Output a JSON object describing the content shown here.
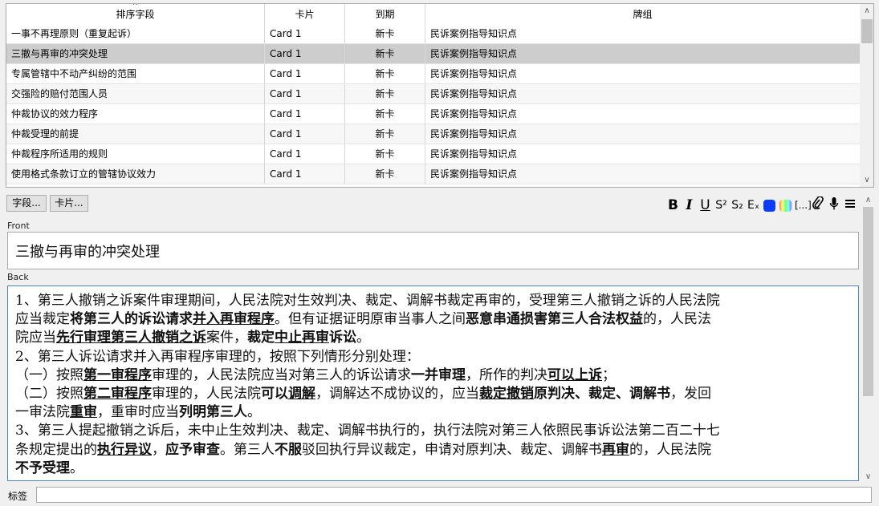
{
  "table": {
    "columns": [
      "排序字段",
      "卡片",
      "到期",
      "牌组"
    ],
    "sort_indicator": "^",
    "rows": [
      {
        "sort_field": "一事不再理原则（重复起诉）",
        "card": "Card 1",
        "due": "新卡",
        "deck": "民诉案例指导知识点",
        "selected": false
      },
      {
        "sort_field": "三撤与再审的冲突处理",
        "card": "Card 1",
        "due": "新卡",
        "deck": "民诉案例指导知识点",
        "selected": true
      },
      {
        "sort_field": "专属管辖中不动产纠纷的范围",
        "card": "Card 1",
        "due": "新卡",
        "deck": "民诉案例指导知识点",
        "selected": false
      },
      {
        "sort_field": "交强险的赔付范围人员",
        "card": "Card 1",
        "due": "新卡",
        "deck": "民诉案例指导知识点",
        "selected": false
      },
      {
        "sort_field": "仲裁协议的效力程序",
        "card": "Card 1",
        "due": "新卡",
        "deck": "民诉案例指导知识点",
        "selected": false
      },
      {
        "sort_field": "仲裁受理的前提",
        "card": "Card 1",
        "due": "新卡",
        "deck": "民诉案例指导知识点",
        "selected": false
      },
      {
        "sort_field": "仲裁程序所适用的规则",
        "card": "Card 1",
        "due": "新卡",
        "deck": "民诉案例指导知识点",
        "selected": false
      },
      {
        "sort_field": "使用格式条款订立的管辖协议效力",
        "card": "Card 1",
        "due": "新卡",
        "deck": "民诉案例指导知识点",
        "selected": false
      }
    ]
  },
  "buttons": {
    "fields": "字段...",
    "cards": "卡片..."
  },
  "toolbar": {
    "bold": "B",
    "italic": "I",
    "underline": "U",
    "superscript": "S²",
    "subscript": "S₂",
    "clear_format": "Eₓ",
    "cloze": "[...]",
    "text_color": "#0a3cff"
  },
  "editor": {
    "front_label": "Front",
    "front_value": "三撤与再审的冲突处理",
    "back_label": "Back",
    "back_value": "1、第三人撤销之诉案件审理期间，人民法院对生效判决、裁定、调解书裁定再审的，受理第三人撤销之诉的人民法院应当裁定将第三人的诉讼请求并入再审程序。但有证据证明原审当事人之间恶意串通损害第三人合法权益的，人民法院应当先行审理第三人撤销之诉案件，裁定中止再审诉讼。2、第三人诉讼请求并入再审程序审理的，按照下列情形分别处理：（一）按照第一审程序审理的，人民法院应当对第三人的诉讼请求一并审理，所作的判决可以上诉；（二）按照第二审程序审理的，人民法院可以调解，调解达不成协议的，应当裁定撤销原判决、裁定、调解书，发回一审法院重审，重审时应当列明第三人。3、第三人提起撤销之诉后，未中止生效判决、裁定、调解书执行的，执行法院对第三人依照民事诉讼法第二百二十七条规定提出的执行异议，应予审查。第三人不服驳回执行异议裁定，申请对原判决、裁定、调解书再审的，人民法院不予受理。",
    "back_lines": {
      "l1a": "1、第三人撤销之诉案件审理期间，人民法院对生效判决、裁定、调解书裁定再审的，受理第三人撤销之诉的人民法院",
      "l2a": "应当裁定",
      "l2b": "将第三人的诉讼请求",
      "l2c": "并入再审程序",
      "l2d": "。但有证据证明原审当事人之间",
      "l2e": "恶意串通损害第三人合法权益",
      "l2f": "的，人民法",
      "l3a": "院应当",
      "l3b": "先行审理第三人撤销之诉",
      "l3c": "案件，",
      "l3d": "裁定",
      "l3e": "中止再审",
      "l3f": "诉讼",
      "l3g": "。",
      "l4": "2、第三人诉讼请求并入再审程序审理的，按照下列情形分别处理：",
      "l5a": "（一）按照",
      "l5b": "第一审程序",
      "l5c": "审理的，人民法院应当对第三人的诉讼请求",
      "l5d": "一并审理",
      "l5e": "，所作的判决",
      "l5f": "可以上诉",
      "l5g": "；",
      "l6a": "（二）按照",
      "l6b": "第二审程序",
      "l6c": "审理的，人民法院",
      "l6d": "可以",
      "l6e": "调解",
      "l6f": "，调解达不成协议的，应当",
      "l6g": "裁定撤销",
      "l6h": "原判决、裁定、调解书",
      "l6i": "，发回",
      "l7a": "一审法院",
      "l7b": "重审",
      "l7c": "，重审时应当",
      "l7d": "列明第三人",
      "l7e": "。",
      "l8": "3、第三人提起撤销之诉后，未中止生效判决、裁定、调解书执行的，执行法院对第三人依照民事诉讼法第二百二十七",
      "l9a": "条规定提出的",
      "l9b": "执行异议",
      "l9c": "，",
      "l9d": "应予审查",
      "l9e": "。第三人",
      "l9f": "不服",
      "l9g": "驳回执行异议裁定，申请对原判决、裁定、调解书",
      "l9h": "再审",
      "l9i": "的，人民法院",
      "l10a": "不予受理",
      "l10b": "。"
    }
  },
  "tags": {
    "label": "标签",
    "value": ""
  }
}
